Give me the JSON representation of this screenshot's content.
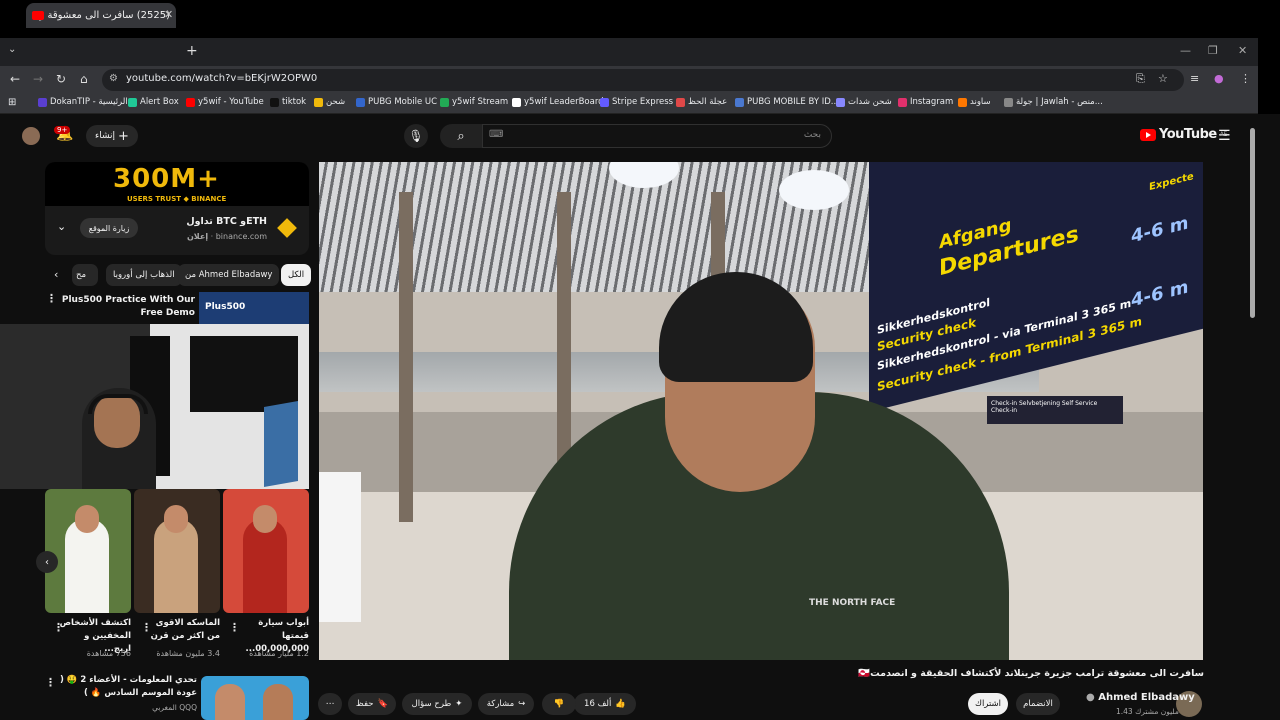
{
  "browser": {
    "tab_title": "(2525) سافرت الى معشوقة ر",
    "url": "youtube.com/watch?v=bEKjrW2OPW0",
    "new_tab": "+",
    "tab_close": "✕",
    "bookmarks": [
      {
        "label": "DokanTIP - الرئيسية",
        "color": "#5a3fd1"
      },
      {
        "label": "Alert Box",
        "color": "#20c997"
      },
      {
        "label": "y5wif - YouTube",
        "color": "#ff0000"
      },
      {
        "label": "tiktok",
        "color": "#111111"
      },
      {
        "label": "شحن",
        "color": "#f0b90b"
      },
      {
        "label": "PUBG Mobile UC",
        "color": "#3366cc"
      },
      {
        "label": "y5wif Stream",
        "color": "#22aa55"
      },
      {
        "label": "y5wif LeaderBoard",
        "color": "#ffffff"
      },
      {
        "label": "Stripe Express",
        "color": "#635bff"
      },
      {
        "label": "عجلة الحظ",
        "color": "#e04848"
      },
      {
        "label": "PUBG MOBILE BY ID...",
        "color": "#4a78d0"
      },
      {
        "label": "شحن شدات",
        "color": "#8888ff"
      },
      {
        "label": "Instagram",
        "color": "#e1306c"
      },
      {
        "label": "ساوند",
        "color": "#ff7700"
      },
      {
        "label": "جولة | Jawlah - منص...",
        "color": "#888888"
      }
    ]
  },
  "youtube": {
    "logo_text": "YouTube",
    "region": "AE",
    "search_placeholder": "بحث",
    "create_label": "إنشاء",
    "notif_count": "9+",
    "ad": {
      "banner_big": "300M+",
      "banner_sub": "USERS TRUST ◆ BINANCE",
      "title": "تداول BTC وETH",
      "label": "إعلان",
      "domain": "binance.com",
      "visit": "زيارة الموقع"
    },
    "chips": [
      {
        "label": "الكل",
        "active": true
      },
      {
        "label": "من Ahmed Elbadawy",
        "active": false
      },
      {
        "label": "الذهاب إلى أوروبا",
        "active": false
      },
      {
        "label": "مح",
        "active": false
      }
    ],
    "rec_top": {
      "title": "Plus500 Practice With Our Free Demo",
      "thumb_text": "Plus500"
    },
    "shorts": [
      {
        "title": "أبواب سيارة قيمتها 00,000,000...",
        "views": "1.2 مليار مشاهدة",
        "color": "#c0392b"
      },
      {
        "title": "الماسكه الاقوى من اكثر من قرن",
        "views": "3.4 مليون مشاهدة",
        "color": "#6e4a2f"
      },
      {
        "title": "اكتشف الأشخاص المخفيين و اربح...",
        "views": "756 مشاهدة",
        "color": "#4b6b3a"
      }
    ],
    "next_video": {
      "title": "تحدي المعلومات - الأعضاء 2 🤑 ( عودة الموسم السادس 🔥 )",
      "channel": "المغربي QQQ"
    },
    "video": {
      "title": "سافرت الى معشوقة ترامب جزيرة جرينلاند لأكتشاف الحقيقة و انصدمت🇬🇱",
      "channel": "Ahmed Elbadawy",
      "subscribers": "1.43 مليون مشترك",
      "likes": "16 ألف",
      "join": "الانضمام",
      "subscribe": "اشتراك",
      "share": "مشاركة",
      "ask": "طرح سؤال",
      "save": "حفظ"
    },
    "sign": {
      "line1": "Afgang",
      "line2": "Departures",
      "line3": "Sikkerhedskontrol",
      "line4": "Security check",
      "line5": "Sikkerhedskontrol - via Terminal 3 365 m",
      "line6": "Security check - from Terminal 3 365 m",
      "time1": "4-6 m",
      "time2": "4-6 m",
      "checkin": "Check-in Selvbetjening  Self Service Check-in",
      "expected": "Expecte"
    },
    "brand_on_jacket": "THE NORTH FACE"
  }
}
